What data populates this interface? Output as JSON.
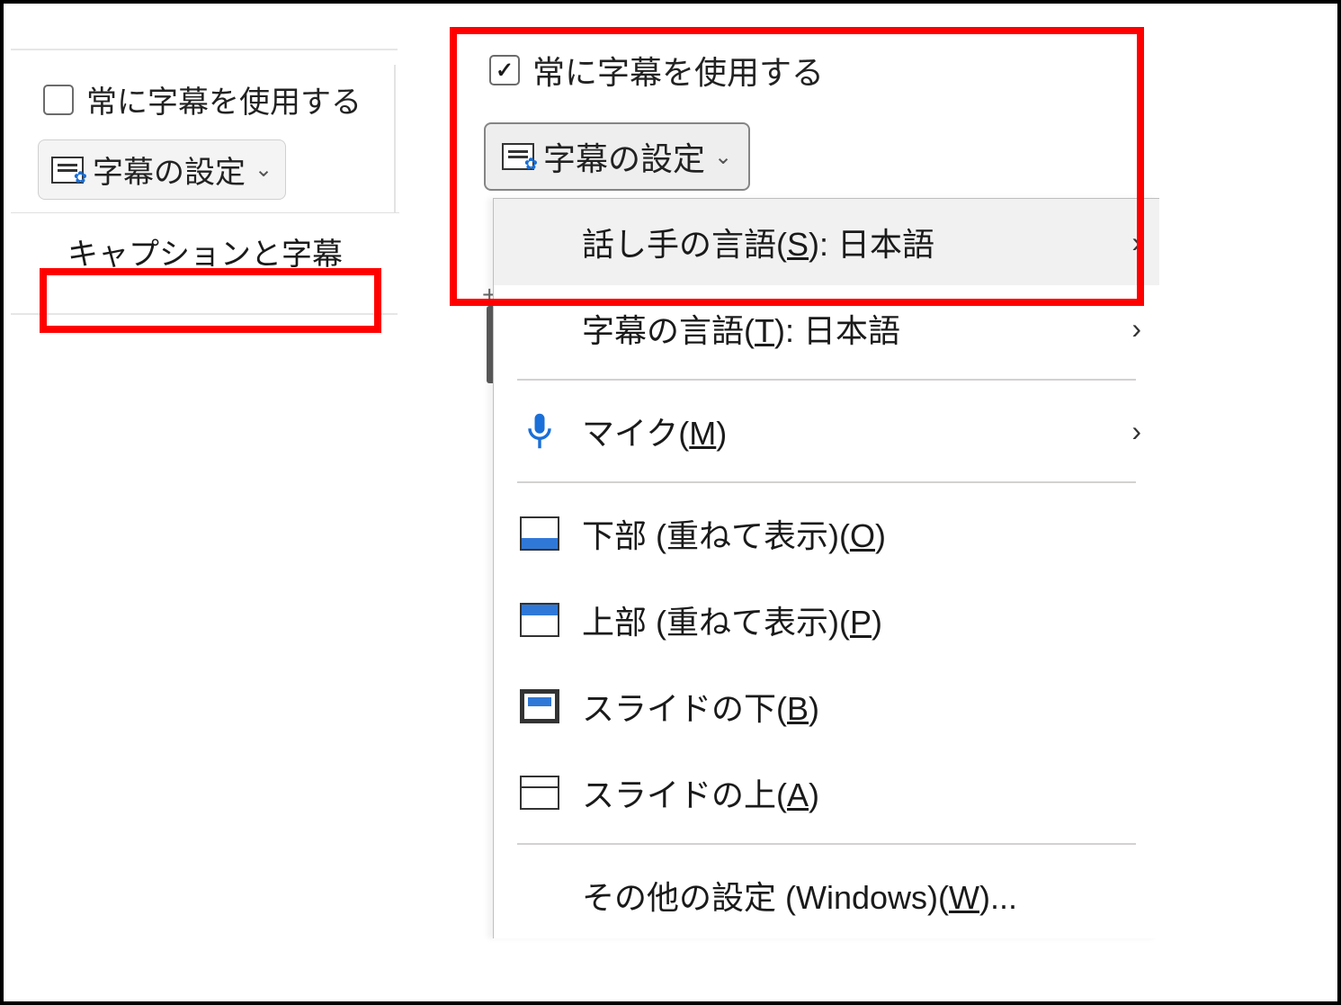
{
  "ribbon": {
    "always_use_label": "常に字幕を使用する",
    "settings_button": "字幕の設定",
    "group_title": "キャプションと字幕"
  },
  "right": {
    "always_use_label": "常に字幕を使用する",
    "settings_button": "字幕の設定"
  },
  "menu": {
    "spoken_lang_pre": "話し手の言語(",
    "spoken_lang_key": "S",
    "spoken_lang_post": "): 日本語",
    "subtitle_lang_pre": "字幕の言語(",
    "subtitle_lang_key": "T",
    "subtitle_lang_post": "): 日本語",
    "mic_pre": "マイク(",
    "mic_key": "M",
    "mic_post": ")",
    "bottom_ovl_pre": "下部 (重ねて表示)(",
    "bottom_ovl_key": "O",
    "bottom_ovl_post": ")",
    "top_ovl_pre": "上部 (重ねて表示)(",
    "top_ovl_key": "P",
    "top_ovl_post": ")",
    "below_pre": "スライドの下(",
    "below_key": "B",
    "below_post": ")",
    "above_pre": "スライドの上(",
    "above_key": "A",
    "above_post": ")",
    "other_pre": "その他の設定 (Windows)(",
    "other_key": "W",
    "other_post": ")..."
  }
}
